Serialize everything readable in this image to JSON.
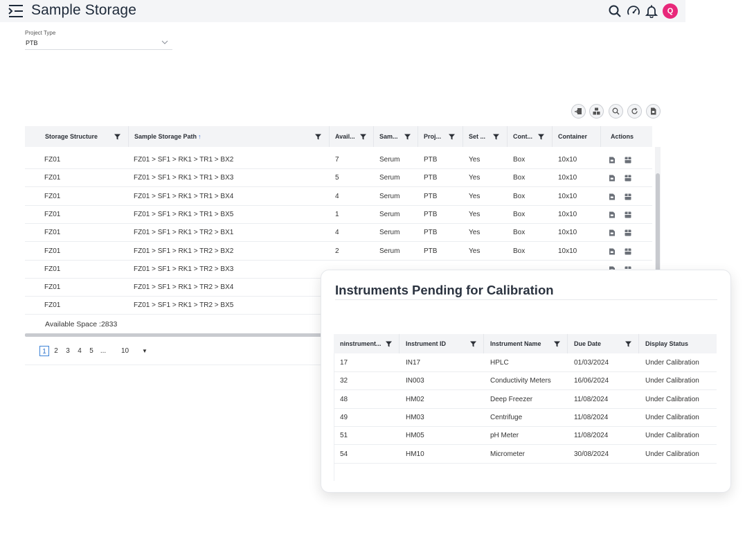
{
  "header": {
    "title": "Sample Storage",
    "avatar_initial": "Q"
  },
  "project_type": {
    "label": "Project Type",
    "value": "PTB"
  },
  "grid": {
    "columns": [
      "Storage Structure",
      "Sample Storage Path",
      "Avail...",
      "Sam...",
      "Proj...",
      "Set ...",
      "Cont...",
      "Container",
      "Actions"
    ],
    "rows": [
      [
        "FZ01",
        "FZ01 > SF1 > RK1 > TR1 > BX2",
        "7",
        "Serum",
        "PTB",
        "Yes",
        "Box",
        "10x10"
      ],
      [
        "FZ01",
        "FZ01 > SF1 > RK1 > TR1 > BX3",
        "5",
        "Serum",
        "PTB",
        "Yes",
        "Box",
        "10x10"
      ],
      [
        "FZ01",
        "FZ01 > SF1 > RK1 > TR1 > BX4",
        "4",
        "Serum",
        "PTB",
        "Yes",
        "Box",
        "10x10"
      ],
      [
        "FZ01",
        "FZ01 > SF1 > RK1 > TR1 > BX5",
        "1",
        "Serum",
        "PTB",
        "Yes",
        "Box",
        "10x10"
      ],
      [
        "FZ01",
        "FZ01 > SF1 > RK1 > TR2 > BX1",
        "4",
        "Serum",
        "PTB",
        "Yes",
        "Box",
        "10x10"
      ],
      [
        "FZ01",
        "FZ01 > SF1 > RK1 > TR2 > BX2",
        "2",
        "Serum",
        "PTB",
        "Yes",
        "Box",
        "10x10"
      ],
      [
        "FZ01",
        "FZ01 > SF1 > RK1 > TR2 > BX3",
        "",
        "",
        "",
        "",
        "",
        ""
      ],
      [
        "FZ01",
        "FZ01 > SF1 > RK1 > TR2 > BX4",
        "",
        "",
        "",
        "",
        "",
        ""
      ],
      [
        "FZ01",
        "FZ01 > SF1 > RK1 > TR2 > BX5",
        "",
        "",
        "",
        "",
        "",
        ""
      ]
    ],
    "footer": "Available Space :2833"
  },
  "pager": {
    "pages": [
      "1",
      "2",
      "3",
      "4",
      "5",
      "..."
    ],
    "page_size": "10"
  },
  "calibration": {
    "title": "Instruments Pending for Calibration",
    "columns": [
      "ninstrument...",
      "Instrument ID",
      "Instrument Name",
      "Due Date",
      "Display Status"
    ],
    "rows": [
      [
        "17",
        "IN17",
        "HPLC",
        "01/03/2024",
        "Under Calibration"
      ],
      [
        "32",
        "IN003",
        "Conductivity Meters",
        "16/06/2024",
        "Under Calibration"
      ],
      [
        "48",
        "HM02",
        "Deep Freezer",
        "11/08/2024",
        "Under Calibration"
      ],
      [
        "49",
        "HM03",
        "Centrifuge",
        "11/08/2024",
        "Under Calibration"
      ],
      [
        "51",
        "HM05",
        "pH Meter",
        "11/08/2024",
        "Under Calibration"
      ],
      [
        "54",
        "HM10",
        "Micrometer",
        "30/08/2024",
        "Under Calibration"
      ]
    ]
  },
  "colors": {
    "accent": "#e8287a",
    "link": "#3b6ed1",
    "header_bg": "#f4f5f7"
  }
}
